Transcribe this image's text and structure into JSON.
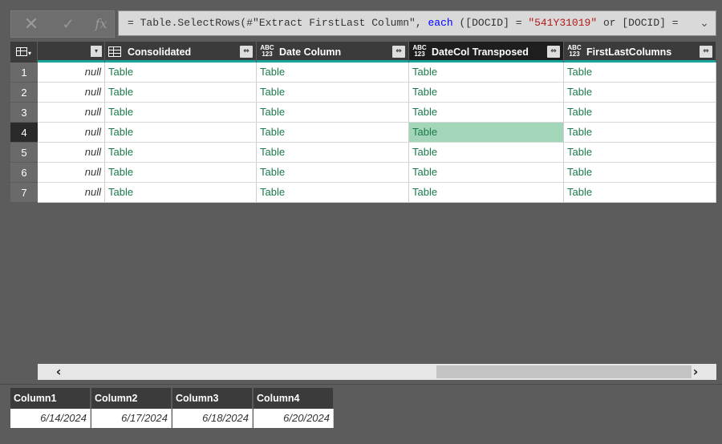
{
  "formula_bar": {
    "cancel_icon": "close-icon",
    "commit_icon": "check-icon",
    "fx_label": "fx",
    "formula_prefix": "= Table.SelectRows(#\"Extract FirstLast Column\", ",
    "formula_keyword": "each",
    "formula_mid": " ([DOCID] = ",
    "formula_string": "\"541Y31019\"",
    "formula_suffix": " or [DOCID] = ",
    "expand_icon": "chevron-down-icon"
  },
  "grid": {
    "columns": [
      {
        "label": "",
        "type": "any"
      },
      {
        "label": "Consolidated",
        "type": "table"
      },
      {
        "label": "Date Column",
        "type": "any",
        "type_text": "ABC\n123"
      },
      {
        "label": "DateCol Transposed",
        "type": "any",
        "type_text": "ABC\n123",
        "selected": true
      },
      {
        "label": "FirstLastColumns",
        "type": "any",
        "type_text": "ABC\n123"
      }
    ],
    "rows": [
      {
        "num": "1",
        "cells": [
          "null",
          "Table",
          "Table",
          "Table",
          "Table"
        ]
      },
      {
        "num": "2",
        "cells": [
          "null",
          "Table",
          "Table",
          "Table",
          "Table"
        ]
      },
      {
        "num": "3",
        "cells": [
          "null",
          "Table",
          "Table",
          "Table",
          "Table"
        ]
      },
      {
        "num": "4",
        "cells": [
          "null",
          "Table",
          "Table",
          "Table",
          "Table"
        ],
        "active": true
      },
      {
        "num": "5",
        "cells": [
          "null",
          "Table",
          "Table",
          "Table",
          "Table"
        ]
      },
      {
        "num": "6",
        "cells": [
          "null",
          "Table",
          "Table",
          "Table",
          "Table"
        ]
      },
      {
        "num": "7",
        "cells": [
          "null",
          "Table",
          "Table",
          "Table",
          "Table"
        ]
      }
    ],
    "type_any_text": "ABC 123"
  },
  "scrollbar": {
    "left_icon": "chevron-left-icon",
    "right_icon": "chevron-right-icon"
  },
  "preview": {
    "headers": [
      "Column1",
      "Column2",
      "Column3",
      "Column4"
    ],
    "values": [
      "6/14/2024",
      "6/17/2024",
      "6/18/2024",
      "6/20/2024"
    ]
  },
  "colors": {
    "accent": "#18a59a",
    "link_text": "#1a7a4a",
    "selected_cell": "#a3d6b8"
  }
}
